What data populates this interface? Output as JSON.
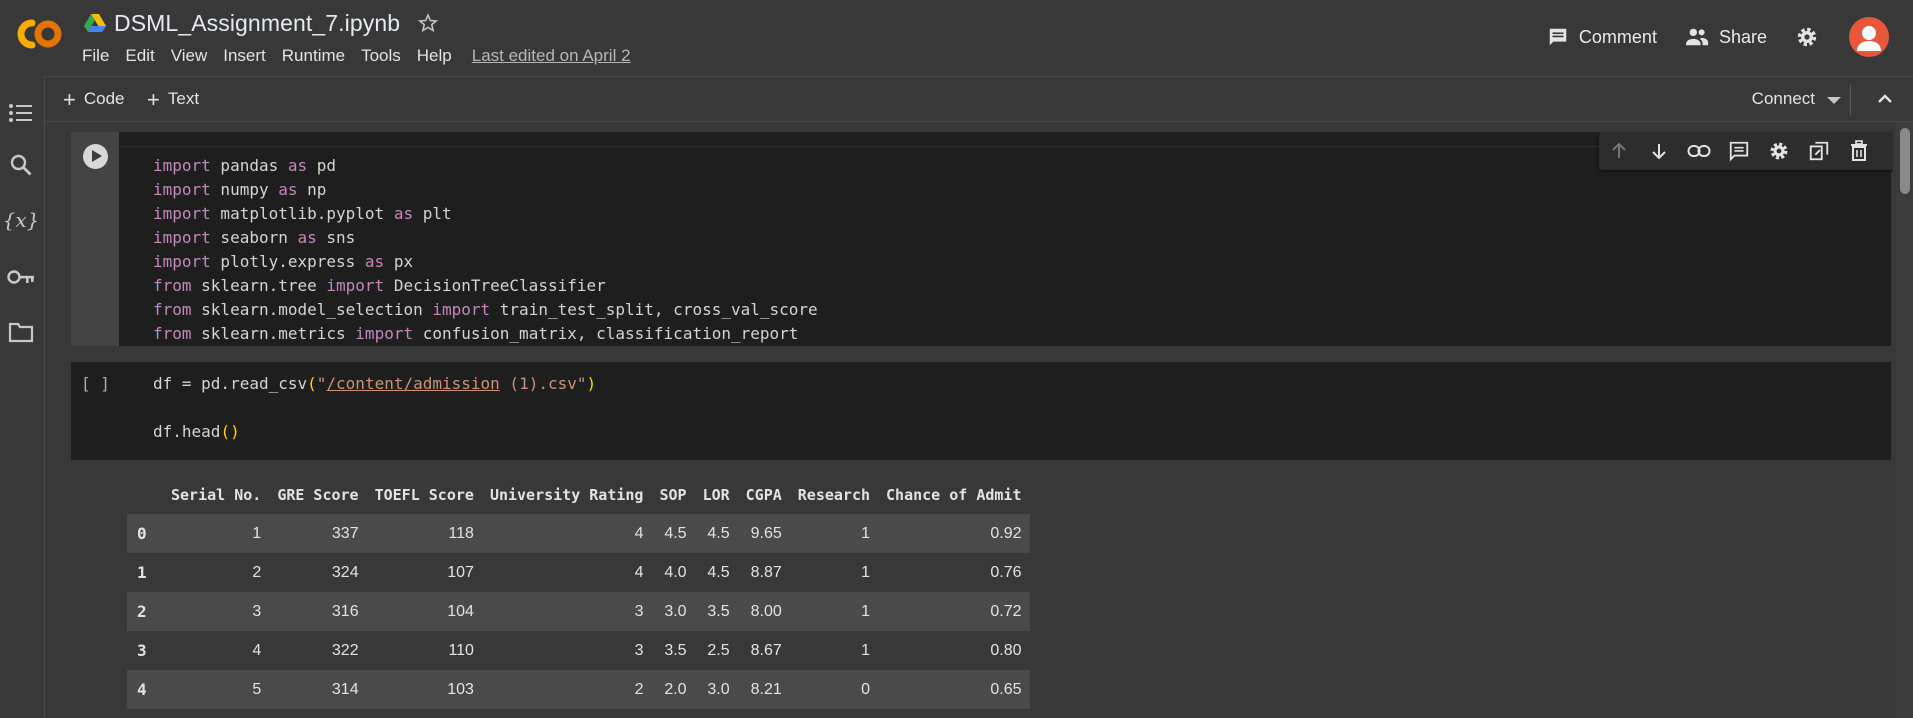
{
  "header": {
    "app_logo_text": "CO",
    "doc_title": "DSML_Assignment_7.ipynb",
    "menu": [
      "File",
      "Edit",
      "View",
      "Insert",
      "Runtime",
      "Tools",
      "Help"
    ],
    "last_edited": "Last edited on April 2",
    "comment_label": "Comment",
    "share_label": "Share"
  },
  "rail": {
    "variables_symbol": "{x}"
  },
  "toolbar": {
    "add_code": "Code",
    "add_text": "Text",
    "connect": "Connect"
  },
  "cell1": {
    "lines": [
      "import pandas as pd",
      "import numpy as np",
      "import matplotlib.pyplot as plt",
      "import seaborn as sns",
      "import plotly.express as px",
      "from sklearn.tree import DecisionTreeClassifier",
      "from sklearn.model_selection import train_test_split, cross_val_score",
      "from sklearn.metrics import confusion_matrix, classification_report"
    ]
  },
  "cell2": {
    "brackets": "[ ]",
    "line1": "df = pd.read_csv(\"/content/admission (1).csv\")",
    "line2": "df.head()"
  },
  "table": {
    "columns": [
      "",
      "Serial No.",
      "GRE Score",
      "TOEFL Score",
      "University Rating",
      "SOP",
      "LOR",
      "CGPA",
      "Research",
      "Chance of Admit"
    ],
    "rows": [
      [
        "0",
        "1",
        "337",
        "118",
        "4",
        "4.5",
        "4.5",
        "9.65",
        "1",
        "0.92"
      ],
      [
        "1",
        "2",
        "324",
        "107",
        "4",
        "4.0",
        "4.5",
        "8.87",
        "1",
        "0.76"
      ],
      [
        "2",
        "3",
        "316",
        "104",
        "3",
        "3.0",
        "3.5",
        "8.00",
        "1",
        "0.72"
      ],
      [
        "3",
        "4",
        "322",
        "110",
        "3",
        "3.5",
        "2.5",
        "8.67",
        "1",
        "0.80"
      ],
      [
        "4",
        "5",
        "314",
        "103",
        "2",
        "2.0",
        "3.0",
        "8.21",
        "0",
        "0.65"
      ]
    ]
  },
  "colors": {
    "background": "#383838",
    "code_bg": "#1e1e1e",
    "keyword": "#c586c0",
    "string": "#ce9178",
    "logo_orange": "#f9ab00",
    "avatar": "#e8563c"
  },
  "icons": [
    "search-icon",
    "key-icon",
    "folder-icon",
    "toc-icon",
    "gear-icon",
    "comment-icon",
    "share-icon",
    "star-icon",
    "drive-icon"
  ]
}
